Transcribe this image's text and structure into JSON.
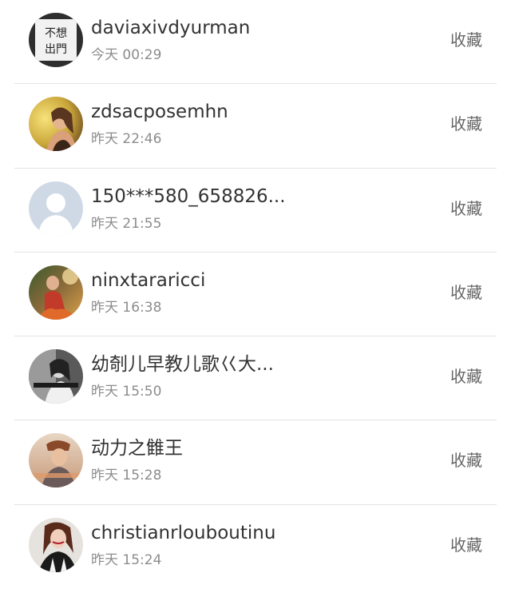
{
  "items": [
    {
      "name": "daviaxivdyurman",
      "time": "今天 00:29",
      "action": "收藏",
      "avatar_text": [
        "不想",
        "出門"
      ]
    },
    {
      "name": "zdsacposemhn",
      "time": "昨天 22:46",
      "action": "收藏"
    },
    {
      "name": "150***580_658826...",
      "time": "昨天 21:55",
      "action": "收藏"
    },
    {
      "name": "ninxtararicci",
      "time": "昨天 16:38",
      "action": "收藏"
    },
    {
      "name": "幼剞儿早教儿歌巜大...",
      "time": "昨天 15:50",
      "action": "收藏"
    },
    {
      "name": "动力之雔王",
      "time": "昨天 15:28",
      "action": "收藏"
    },
    {
      "name": "christianrlouboutinu",
      "time": "昨天 15:24",
      "action": "收藏"
    }
  ],
  "colors": {
    "name_text": "#333333",
    "time_text": "#8c8c8c",
    "action_text": "#666666",
    "divider": "#e3e3e3",
    "default_avatar_bg": "#cfd9e6"
  }
}
